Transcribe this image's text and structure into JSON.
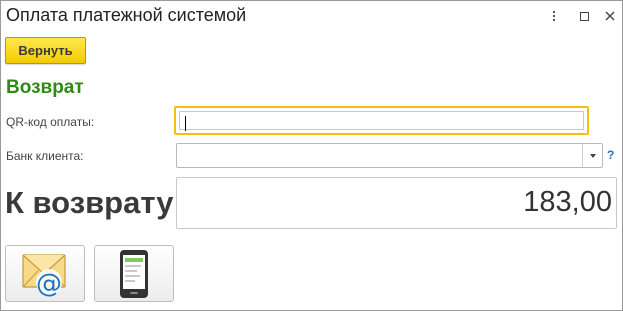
{
  "window": {
    "title": "Оплата платежной системой"
  },
  "toolbar": {
    "back_label": "Вернуть"
  },
  "section": {
    "heading": "Возврат"
  },
  "fields": {
    "qr_label": "QR-код оплаты:",
    "qr_value": "",
    "bank_label": "Банк клиента:",
    "bank_value": "",
    "help": "?"
  },
  "refund": {
    "label": "К возврату:",
    "amount": "183,00"
  },
  "actions": {
    "email_icon": "envelope-at-icon",
    "phone_icon": "smartphone-icon"
  },
  "colors": {
    "accent_yellow": "#f5d000",
    "heading_green": "#2f8a16",
    "focus_border": "#f2c10f",
    "help_blue": "#2a6fc0"
  }
}
